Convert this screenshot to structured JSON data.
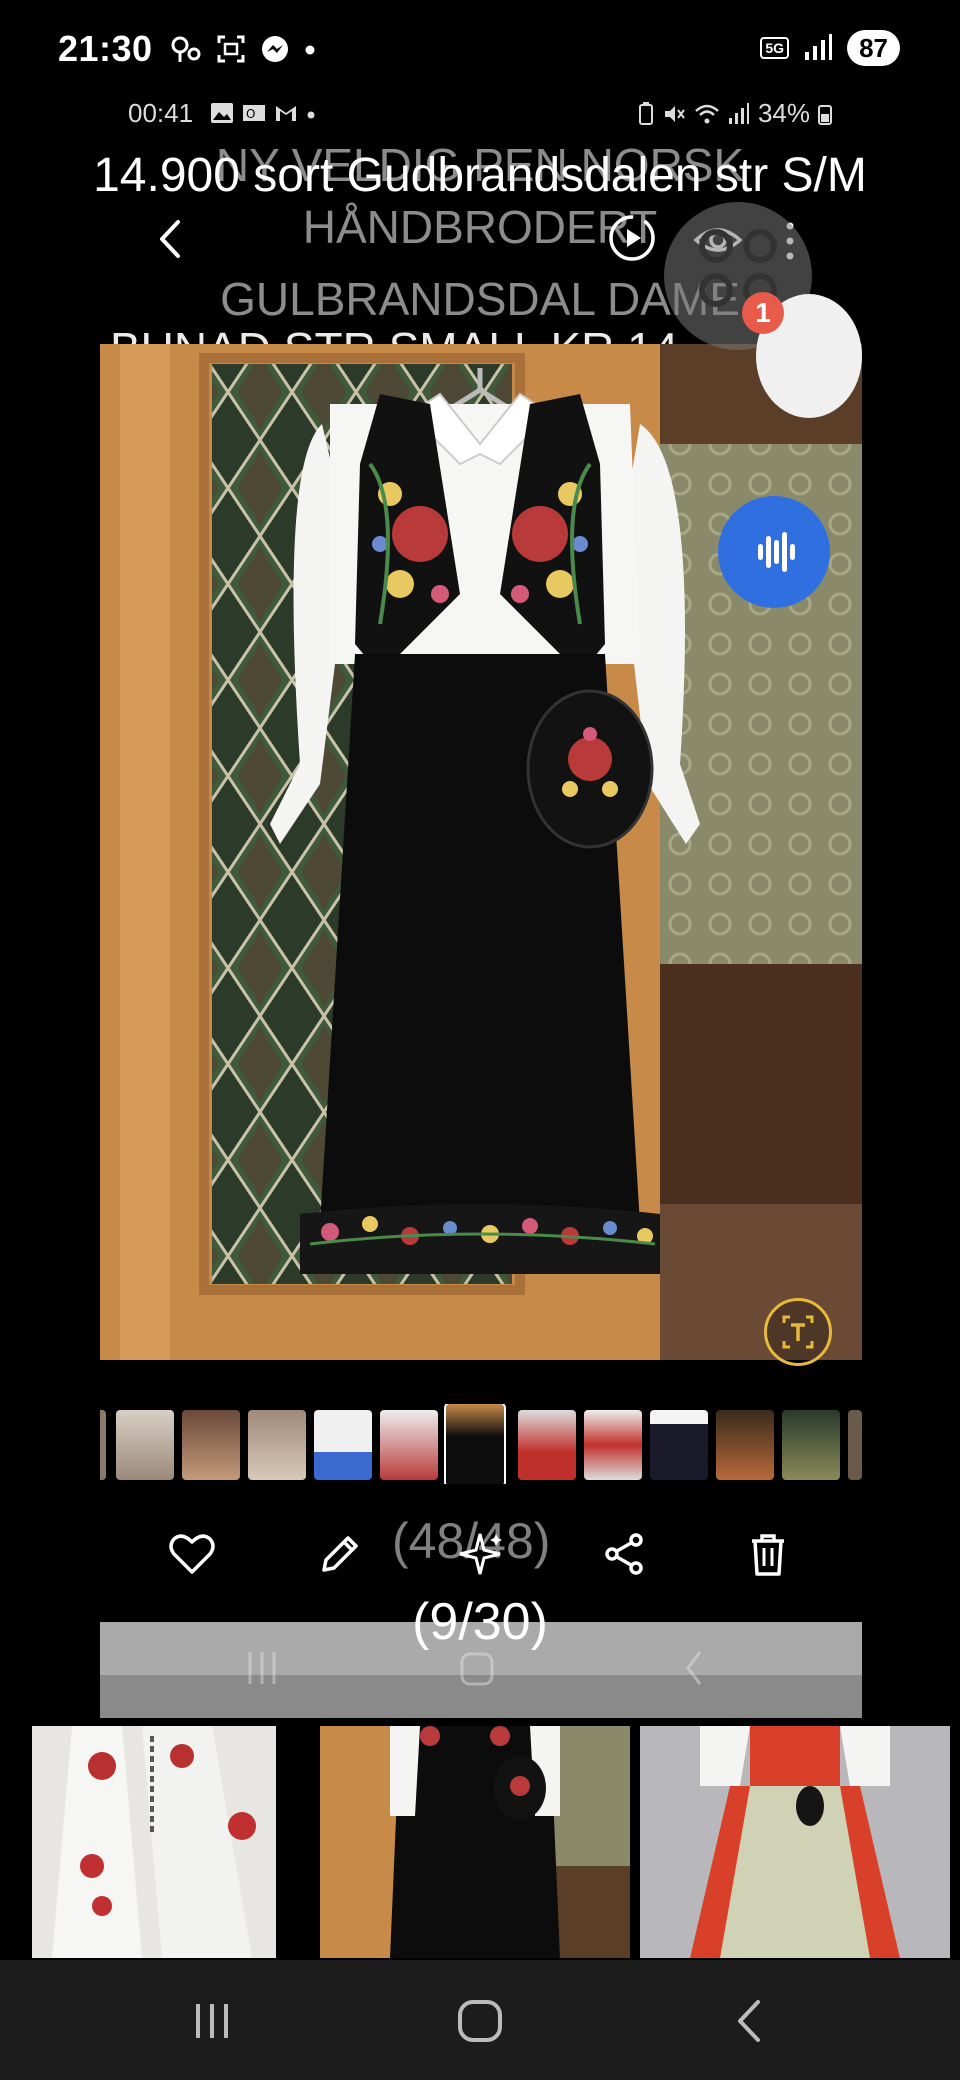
{
  "status_bar": {
    "time": "21:30",
    "network": "5G",
    "battery": "87"
  },
  "inner_status_bar": {
    "time": "00:41",
    "battery": "34%"
  },
  "captions": {
    "main": "14.900 sort Gudbrandsdalen str S/M",
    "ghost_line1": "NY VELDIG PEN NORSK",
    "ghost_line2": "HÅNDBRODERT",
    "ghost_line3": "GULBRANDSDAL  DAME",
    "ghost_line4": "BUNAD STR SMALL  KR 14,"
  },
  "bubble": {
    "badge": "1"
  },
  "viewer": {
    "counter_ghost": "(48/48)",
    "counter_main": "(9/30)"
  },
  "colors": {
    "accent_blue": "#2f6fe0",
    "badge_red": "#e85a4a",
    "scan_yellow": "#e7b93a"
  },
  "icons": {
    "back": "chevron-left-icon",
    "motion": "motion-photo-icon",
    "view": "eye-icon",
    "more": "more-vertical-icon",
    "assistant": "voice-assistant-icon",
    "scan": "text-scan-icon",
    "favorite": "heart-icon",
    "edit": "pencil-icon",
    "enhance": "sparkle-icon",
    "share": "share-icon",
    "delete": "trash-icon",
    "recents": "recents-icon",
    "home": "home-icon",
    "nav_back": "back-icon"
  }
}
